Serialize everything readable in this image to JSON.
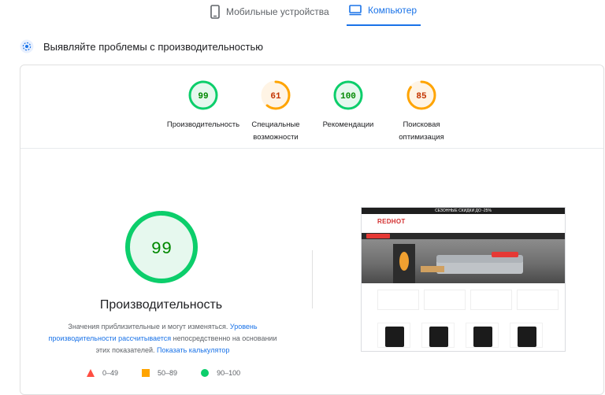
{
  "tabs": {
    "mobile_label": "Мобильные устройства",
    "desktop_label": "Компьютер",
    "active": "desktop"
  },
  "section": {
    "title": "Выявляйте проблемы с производительностью"
  },
  "gauges": [
    {
      "score": "99",
      "label_line1": "Производительность",
      "label_line2": "",
      "status": "pass",
      "fill": 0.99
    },
    {
      "score": "61",
      "label_line1": "Специальные",
      "label_line2": "возможности",
      "status": "average",
      "fill": 0.61
    },
    {
      "score": "100",
      "label_line1": "Рекомендации",
      "label_line2": "",
      "status": "pass",
      "fill": 1.0
    },
    {
      "score": "85",
      "label_line1": "Поисковая",
      "label_line2": "оптимизация",
      "status": "average",
      "fill": 0.85
    }
  ],
  "performance": {
    "score": "99",
    "fill": 0.99,
    "title": "Производительность",
    "note_prefix": "Значения приблизительные и могут изменяться.",
    "note_link1": "Уровень производительности рассчитывается",
    "note_mid": "непосредственно на основании этих показателей.",
    "note_link2": "Показать калькулятор"
  },
  "legend": [
    {
      "range": "0–49",
      "shape": "triangle",
      "color": "#ff4e42"
    },
    {
      "range": "50–89",
      "shape": "square",
      "color": "#ffa400"
    },
    {
      "range": "90–100",
      "shape": "circle",
      "color": "#0cce6b"
    }
  ],
  "screenshot": {
    "banner": "СЕЗОННЫЕ СКИДКИ ДО -25%",
    "logo": "REDHOT"
  },
  "colors": {
    "pass": "#0cce6b",
    "pass_text": "#008800",
    "pass_bg": "#e6f8ee",
    "average": "#ffa400",
    "average_text": "#c33300",
    "average_bg": "#fff4e5",
    "accent": "#1a73e8"
  }
}
